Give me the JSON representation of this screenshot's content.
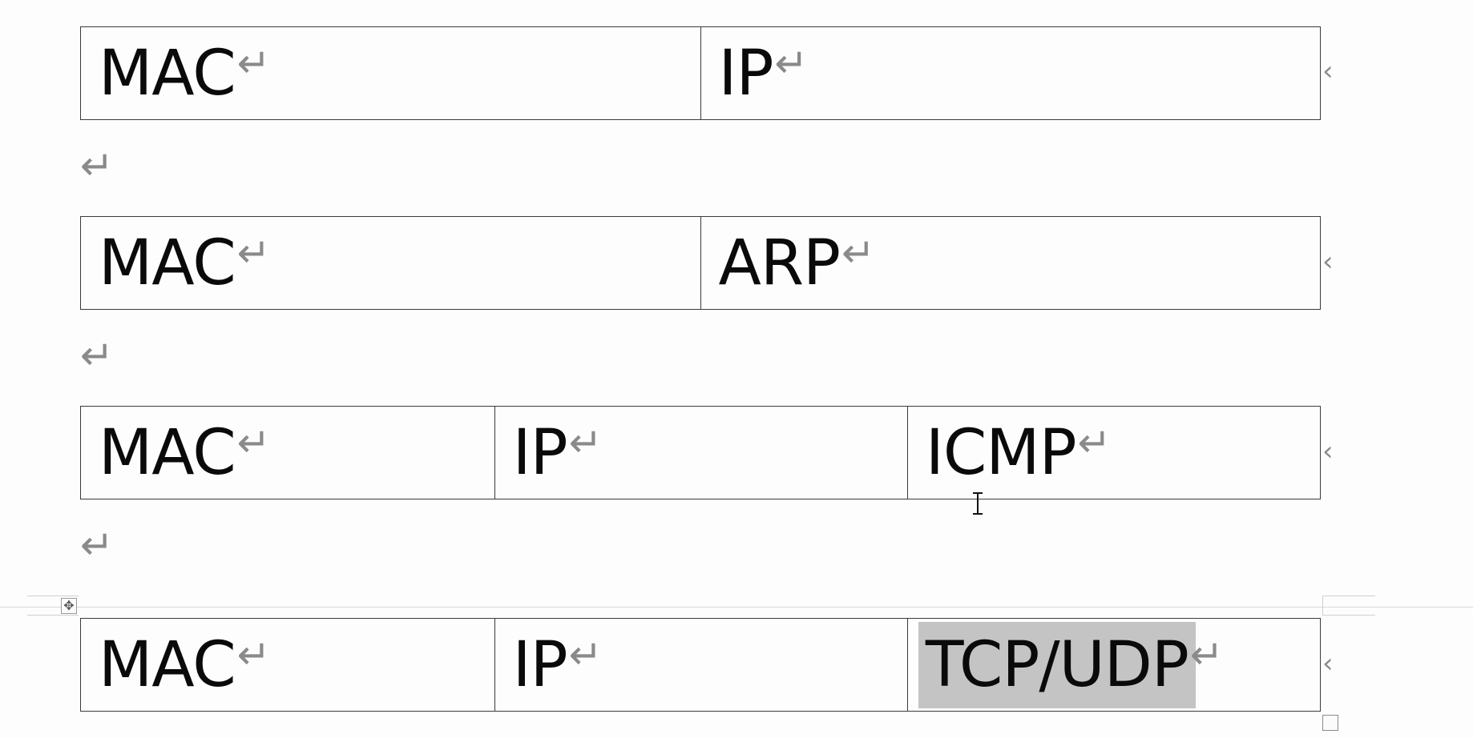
{
  "document": {
    "paragraph_mark": "↵",
    "row_end_mark": "‹",
    "tables": [
      {
        "cells": [
          {
            "text": "MAC",
            "mark": "↵"
          },
          {
            "text": "IP",
            "mark": "↵"
          }
        ]
      },
      {
        "cells": [
          {
            "text": "MAC",
            "mark": "↵"
          },
          {
            "text": "ARP",
            "mark": "↵"
          }
        ]
      },
      {
        "cells": [
          {
            "text": "MAC",
            "mark": "↵"
          },
          {
            "text": "IP",
            "mark": "↵"
          },
          {
            "text": "ICMP",
            "mark": "↵"
          }
        ]
      },
      {
        "cells": [
          {
            "text": "MAC",
            "mark": "↵"
          },
          {
            "text": "IP",
            "mark": "↵"
          },
          {
            "text": "TCP/UDP",
            "mark": "↵",
            "selected": true
          }
        ]
      }
    ],
    "table_move_handle_icon": "move-arrows-icon",
    "table_move_handle_glyph": "✥",
    "table_resize_handle_icon": "resize-square-icon",
    "cursor_icon": "text-i-beam-cursor",
    "selection_color": "#c4c4c4"
  }
}
